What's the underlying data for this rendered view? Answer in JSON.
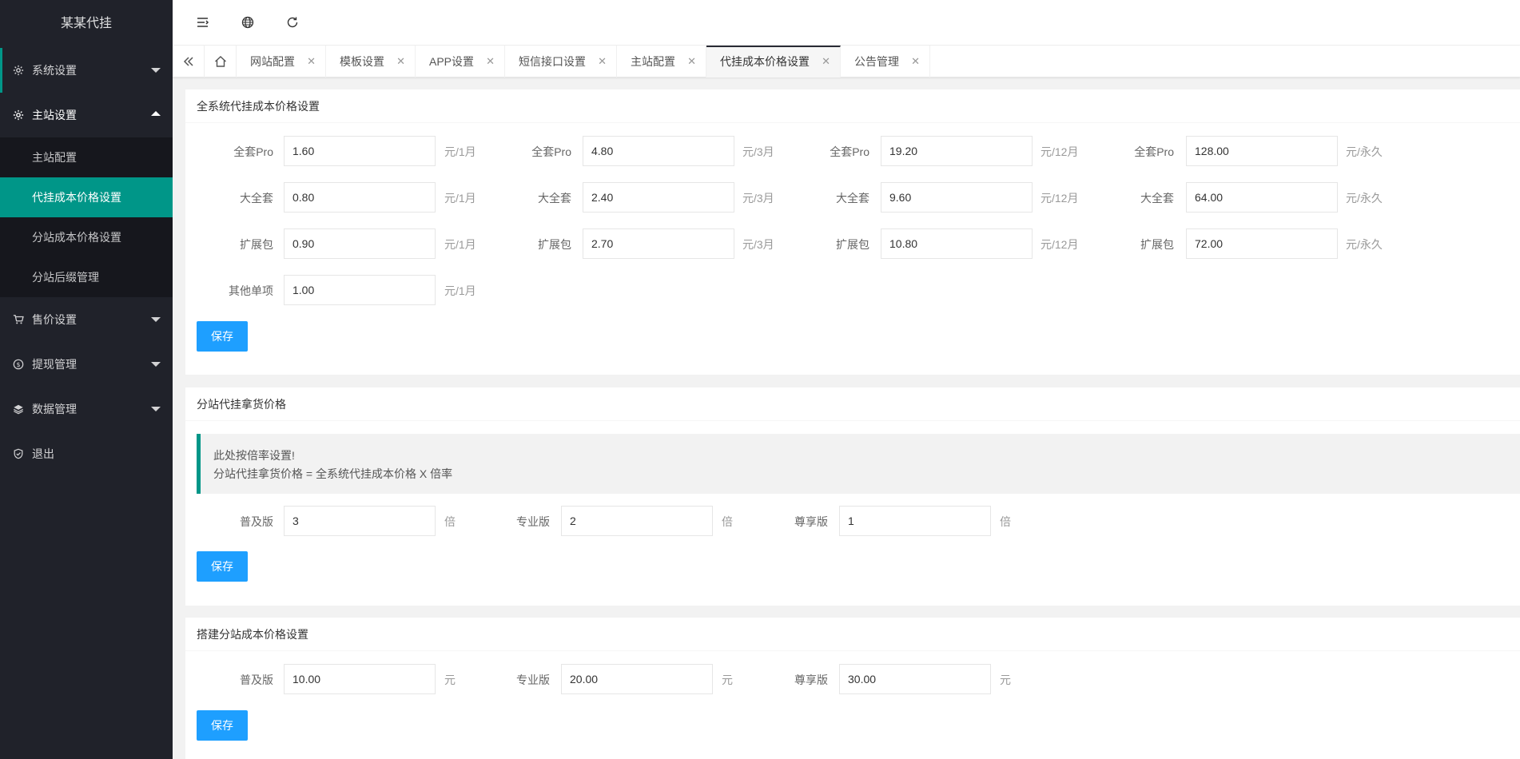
{
  "app": {
    "logo": "某某代挂"
  },
  "sidebar": {
    "menu": [
      {
        "label": "系统设置",
        "icon": "gear-icon"
      },
      {
        "label": "主站设置",
        "icon": "gear-icon"
      },
      {
        "label": "售价设置",
        "icon": "cart-icon"
      },
      {
        "label": "提现管理",
        "icon": "dollar-icon"
      },
      {
        "label": "数据管理",
        "icon": "layers-icon"
      },
      {
        "label": "退出",
        "icon": "shield-icon"
      }
    ],
    "submenu": [
      "主站配置",
      "代挂成本价格设置",
      "分站成本价格设置",
      "分站后缀管理"
    ]
  },
  "tabs": [
    "网站配置",
    "模板设置",
    "APP设置",
    "短信接口设置",
    "主站配置",
    "代挂成本价格设置",
    "公告管理"
  ],
  "section1": {
    "title": "全系统代挂成本价格设置",
    "rows": [
      {
        "label": "全套Pro",
        "values": [
          "1.60",
          "4.80",
          "19.20",
          "128.00"
        ]
      },
      {
        "label": "大全套",
        "values": [
          "0.80",
          "2.40",
          "9.60",
          "64.00"
        ]
      },
      {
        "label": "扩展包",
        "values": [
          "0.90",
          "2.70",
          "10.80",
          "72.00"
        ]
      }
    ],
    "units": [
      "元/1月",
      "元/3月",
      "元/12月",
      "元/永久"
    ],
    "other": {
      "label": "其他单项",
      "value": "1.00",
      "unit": "元/1月"
    },
    "save": "保存"
  },
  "section2": {
    "title": "分站代挂拿货价格",
    "note_line1": "此处按倍率设置!",
    "note_line2": "分站代挂拿货价格 = 全系统代挂成本价格 X 倍率",
    "fields": [
      {
        "label": "普及版",
        "value": "3",
        "unit": "倍"
      },
      {
        "label": "专业版",
        "value": "2",
        "unit": "倍"
      },
      {
        "label": "尊享版",
        "value": "1",
        "unit": "倍"
      }
    ],
    "save": "保存"
  },
  "section3": {
    "title": "搭建分站成本价格设置",
    "fields": [
      {
        "label": "普及版",
        "value": "10.00",
        "unit": "元"
      },
      {
        "label": "专业版",
        "value": "20.00",
        "unit": "元"
      },
      {
        "label": "尊享版",
        "value": "30.00",
        "unit": "元"
      }
    ],
    "save": "保存"
  }
}
